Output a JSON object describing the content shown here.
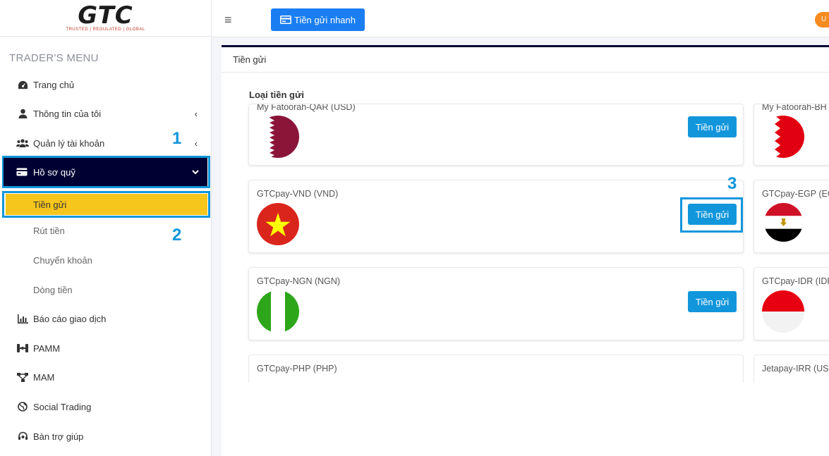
{
  "logo": {
    "text": "GTC",
    "tagline": "TRUSTED | REGULATED | GLOBAL"
  },
  "sidebar": {
    "menu_title": "TRADER'S MENU",
    "items": [
      {
        "label": "Trang chủ",
        "icon": "dashboard-icon"
      },
      {
        "label": "Thông tin của tôi",
        "icon": "user-icon"
      },
      {
        "label": "Quản lý tài khoản",
        "icon": "users-icon"
      },
      {
        "label": "Hồ sơ quỹ",
        "icon": "card-icon"
      },
      {
        "label": "Báo cáo giao dịch",
        "icon": "bar-chart-icon"
      },
      {
        "label": "PAMM",
        "icon": "pamm-icon"
      },
      {
        "label": "MAM",
        "icon": "network-icon"
      },
      {
        "label": "Social Trading",
        "icon": "globe-icon"
      },
      {
        "label": "Bàn trợ giúp",
        "icon": "headset-icon"
      }
    ],
    "sub_items": [
      "Tiền gửi",
      "Rút tiền",
      "Chuyển khoản",
      "Dòng tiền"
    ]
  },
  "annotations": {
    "one": "1",
    "two": "2",
    "three": "3",
    "color": "#1296db"
  },
  "topbar": {
    "quick_deposit": "Tiền gửi nhanh",
    "avatar_initial": "U"
  },
  "panel": {
    "title": "Tiền gửi",
    "section_label": "Loại tiền gửi"
  },
  "cards": [
    {
      "name": "My Fatoorah-QAR (USD)",
      "button": "Tiền gửi",
      "flag": "qatar"
    },
    {
      "name": "My Fatoorah-BH",
      "button": "",
      "flag": "bahrain"
    },
    {
      "name": "GTCpay-VND (VND)",
      "button": "Tiền gửi",
      "flag": "vietnam"
    },
    {
      "name": "GTCpay-EGP (EG",
      "button": "",
      "flag": "egypt"
    },
    {
      "name": "GTCpay-NGN (NGN)",
      "button": "Tiền gửi",
      "flag": "nigeria"
    },
    {
      "name": "GTCpay-IDR (IDR",
      "button": "",
      "flag": "indonesia"
    },
    {
      "name": "GTCpay-PHP (PHP)",
      "button": "",
      "flag": ""
    },
    {
      "name": "Jetapay-IRR (US",
      "button": "",
      "flag": ""
    }
  ],
  "colors": {
    "navy": "#000033",
    "accent_yellow": "#f7c61d",
    "primary_blue": "#1a7ef2",
    "button_blue": "#1296db",
    "orange": "#f68b1f"
  }
}
